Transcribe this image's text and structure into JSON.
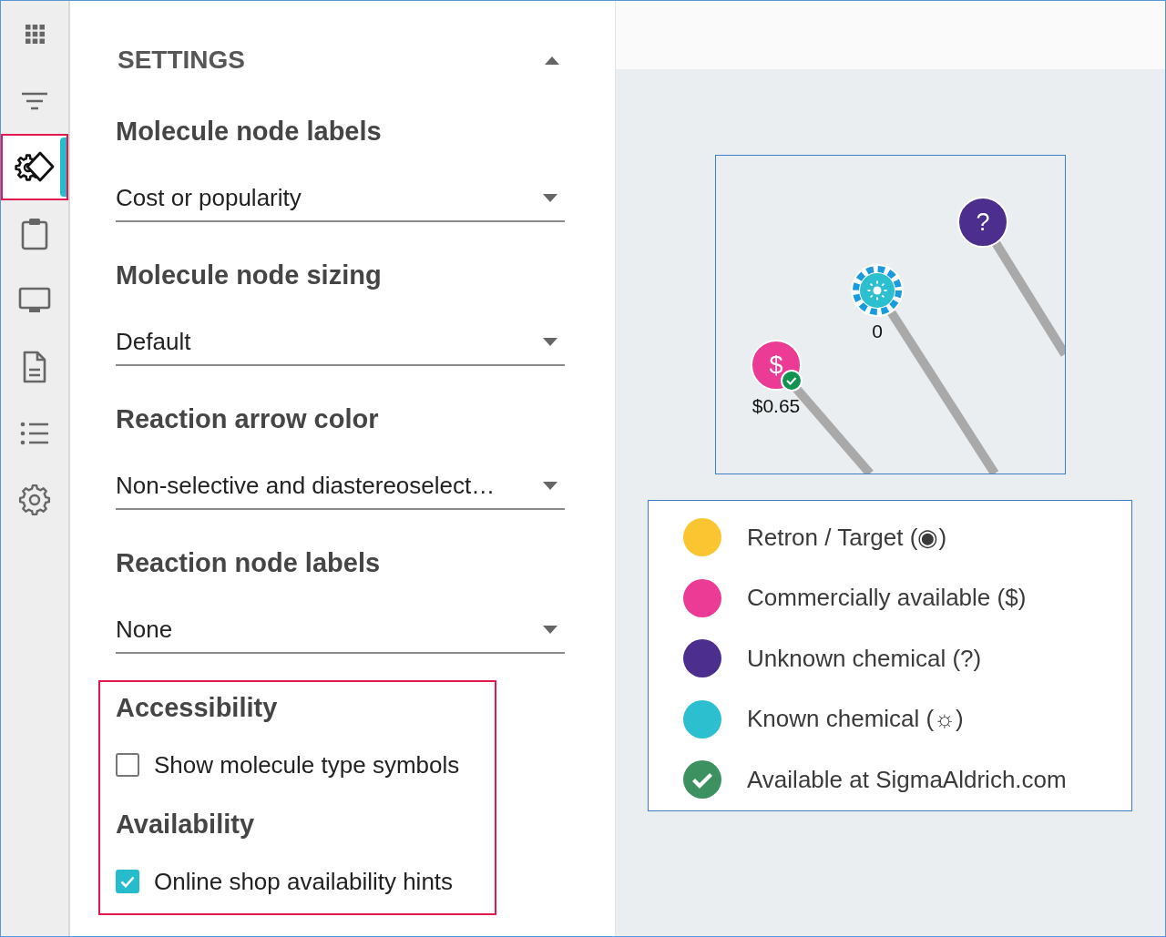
{
  "sidebar": {
    "items": [
      {
        "selected": false,
        "highlighted": false
      },
      {
        "selected": false,
        "highlighted": false
      },
      {
        "selected": true,
        "highlighted": true
      },
      {
        "selected": false,
        "highlighted": false
      },
      {
        "selected": false,
        "highlighted": false
      },
      {
        "selected": false,
        "highlighted": false
      },
      {
        "selected": false,
        "highlighted": false
      },
      {
        "selected": false,
        "highlighted": false
      }
    ]
  },
  "settings": {
    "title": "SETTINGS",
    "expanded": true,
    "dropdowns": [
      {
        "label": "Molecule node labels",
        "value": "Cost or popularity"
      },
      {
        "label": "Molecule node sizing",
        "value": "Default"
      },
      {
        "label": "Reaction arrow color",
        "value": "Non-selective and diastereoselect…"
      },
      {
        "label": "Reaction node labels",
        "value": "None"
      }
    ],
    "options": {
      "highlighted": true,
      "groups": [
        {
          "title": "Accessibility",
          "checkbox": {
            "label": "Show molecule type symbols",
            "checked": false
          }
        },
        {
          "title": "Availability",
          "checkbox": {
            "label": "Online shop availability hints",
            "checked": true
          }
        }
      ]
    }
  },
  "graph": {
    "nodes": [
      {
        "kind": "commercial",
        "color": "#ec3b94",
        "symbol": "$",
        "label": "$0.65",
        "available": true,
        "selected": false
      },
      {
        "kind": "known",
        "color": "#2bbfcf",
        "label": "0",
        "available": false,
        "selected": true
      },
      {
        "kind": "unknown",
        "color": "#4b2e8e",
        "symbol": "?",
        "available": false,
        "selected": false
      }
    ]
  },
  "legend": {
    "items": [
      {
        "kind": "dot",
        "color": "#fbc531",
        "label": "Retron / Target (◉)"
      },
      {
        "kind": "dot",
        "color": "#ec3b94",
        "label": "Commercially available ($)"
      },
      {
        "kind": "dot",
        "color": "#4b2e8e",
        "label": "Unknown chemical (?)"
      },
      {
        "kind": "dot",
        "color": "#2bbfcf",
        "label": "Known chemical (☼)"
      },
      {
        "kind": "check",
        "color": "#3d9160",
        "label": "Available at SigmaAldrich.com"
      }
    ]
  }
}
